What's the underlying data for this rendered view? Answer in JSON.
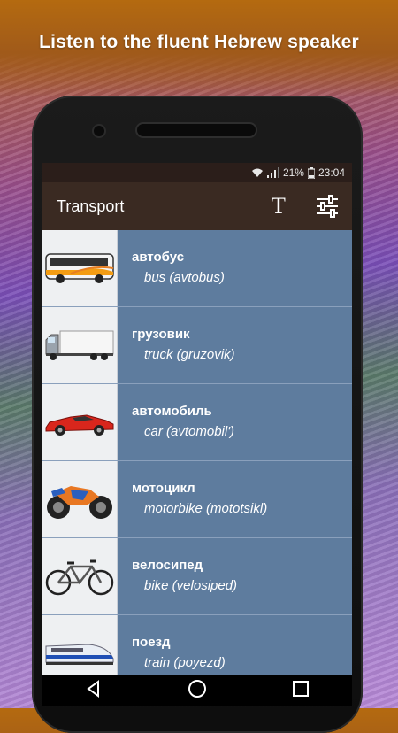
{
  "promo": {
    "title": "Listen to the fluent Hebrew speaker"
  },
  "status_bar": {
    "battery": "21%",
    "time": "23:04"
  },
  "app_bar": {
    "title": "Transport",
    "text_button_glyph": "T"
  },
  "items": [
    {
      "word": "автобус",
      "translation": "bus (avtobus)",
      "icon": "bus-icon"
    },
    {
      "word": "грузовик",
      "translation": "truck (gruzovik)",
      "icon": "truck-icon"
    },
    {
      "word": "автомобиль",
      "translation": "car (avtomobil')",
      "icon": "car-icon"
    },
    {
      "word": "мотоцикл",
      "translation": "motorbike (mototsikl)",
      "icon": "motorbike-icon"
    },
    {
      "word": "велосипед",
      "translation": "bike (velosiped)",
      "icon": "bike-icon"
    },
    {
      "word": "поезд",
      "translation": "train (poyezd)",
      "icon": "train-icon"
    }
  ],
  "colors": {
    "app_bar": "#3a2a22",
    "status_bar": "#2b1e1a",
    "list_row": "#5e7c9e",
    "thumbnail_bg": "#eef0f2"
  }
}
